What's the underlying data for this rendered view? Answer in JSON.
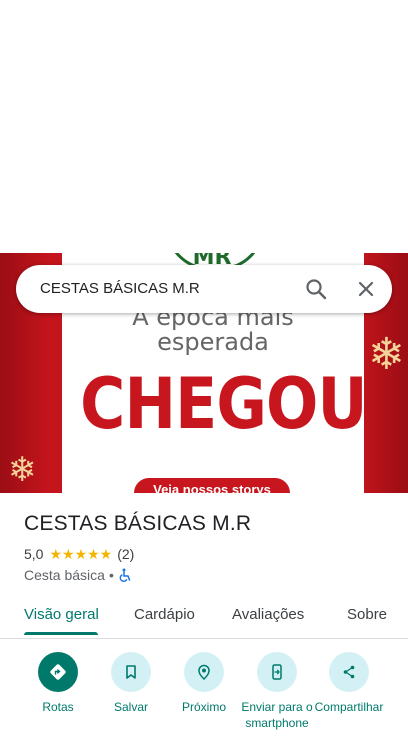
{
  "search": {
    "query": "CESTAS BÁSICAS M.R"
  },
  "hero": {
    "logo_text": "MR",
    "line1": "A época mais",
    "line2": "esperada",
    "headline": "CHEGOU",
    "cta": "Veja nossos storys"
  },
  "place": {
    "name": "CESTAS BÁSICAS M.R",
    "rating": "5,0",
    "stars": "★★★★★",
    "review_count": "(2)",
    "category": "Cesta básica",
    "separator": "•"
  },
  "tabs": [
    {
      "label": "Visão geral",
      "active": true
    },
    {
      "label": "Cardápio",
      "active": false
    },
    {
      "label": "Avaliações",
      "active": false
    },
    {
      "label": "Sobre",
      "active": false
    }
  ],
  "actions": [
    {
      "label": "Rotas",
      "icon": "directions-icon"
    },
    {
      "label": "Salvar",
      "icon": "bookmark-icon"
    },
    {
      "label": "Próximo",
      "icon": "nearby-icon"
    },
    {
      "label": "Enviar para o smartphone",
      "icon": "send-to-phone-icon"
    },
    {
      "label": "Compartilhar",
      "icon": "share-icon"
    }
  ],
  "colors": {
    "accent": "#00796b",
    "action_bg": "#d3f1f5",
    "star": "#f4b400",
    "hero_red": "#c4141c"
  }
}
